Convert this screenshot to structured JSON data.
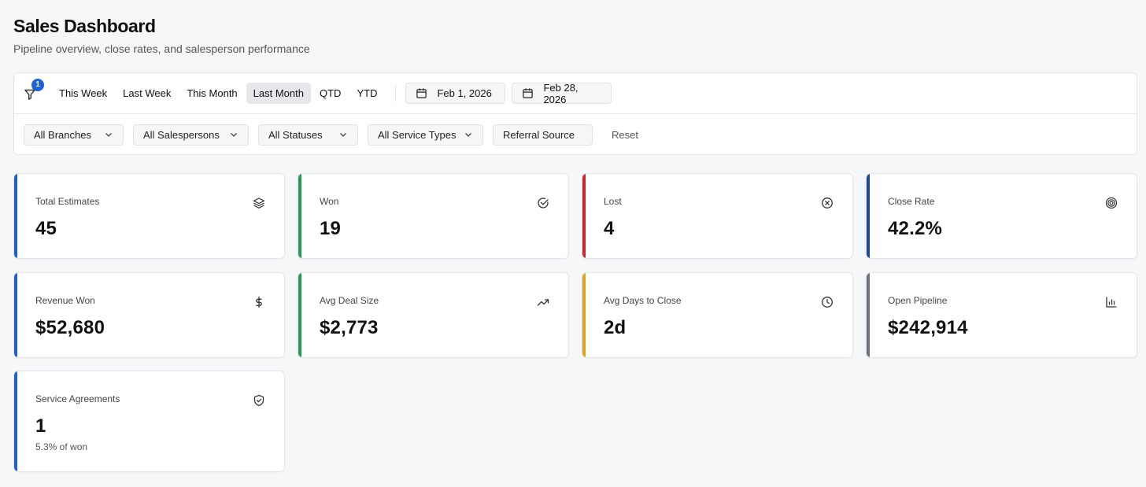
{
  "header": {
    "title": "Sales Dashboard",
    "subtitle": "Pipeline overview, close rates, and salesperson performance"
  },
  "filters": {
    "active_filter_count": "1",
    "presets": [
      {
        "label": "This Week",
        "active": false
      },
      {
        "label": "Last Week",
        "active": false
      },
      {
        "label": "This Month",
        "active": false
      },
      {
        "label": "Last Month",
        "active": true
      },
      {
        "label": "QTD",
        "active": false
      },
      {
        "label": "YTD",
        "active": false
      }
    ],
    "start_date": "Feb 1, 2026",
    "end_date": "Feb 28, 2026",
    "branches": "All Branches",
    "salespersons": "All Salespersons",
    "statuses": "All Statuses",
    "service_types": "All Service Types",
    "referral_source": "Referral Source",
    "reset_label": "Reset"
  },
  "metrics": [
    {
      "label": "Total Estimates",
      "value": "45",
      "icon": "layers-icon",
      "accent": "#1f5fcc"
    },
    {
      "label": "Won",
      "value": "19",
      "icon": "check-circle-icon",
      "accent": "#1f9d55"
    },
    {
      "label": "Lost",
      "value": "4",
      "icon": "x-circle-icon",
      "accent": "#c8262d"
    },
    {
      "label": "Close Rate",
      "value": "42.2%",
      "icon": "target-icon",
      "accent": "#1b4a9c"
    },
    {
      "label": "Revenue Won",
      "value": "$52,680",
      "icon": "dollar-icon",
      "accent": "#1f5fcc"
    },
    {
      "label": "Avg Deal Size",
      "value": "$2,773",
      "icon": "trending-up-icon",
      "accent": "#1f9d55"
    },
    {
      "label": "Avg Days to Close",
      "value": "2d",
      "icon": "clock-icon",
      "accent": "#e0a21a"
    },
    {
      "label": "Open Pipeline",
      "value": "$242,914",
      "icon": "bar-chart-icon",
      "accent": "#6b7280"
    },
    {
      "label": "Service Agreements",
      "value": "1",
      "note": "5.3% of won",
      "icon": "shield-check-icon",
      "accent": "#1f5fcc"
    }
  ]
}
